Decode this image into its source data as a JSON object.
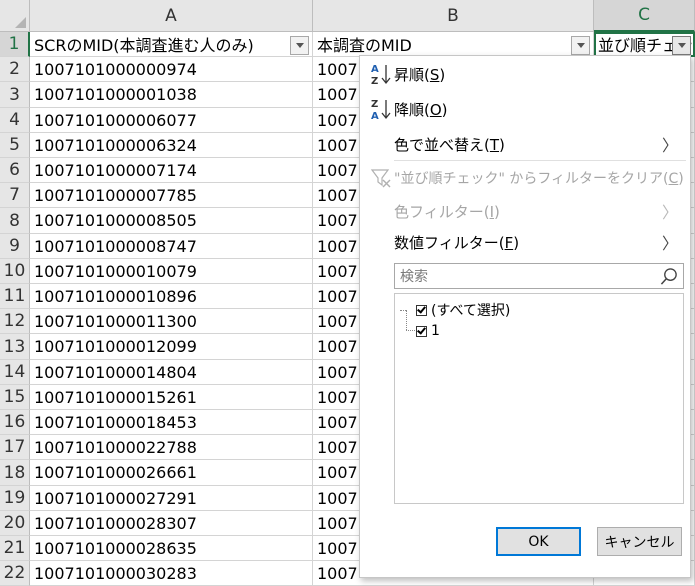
{
  "columns": [
    {
      "letter": "A",
      "header": "SCRのMID(本調査進む人のみ)"
    },
    {
      "letter": "B",
      "header": "本調査のMID"
    },
    {
      "letter": "C",
      "header": "並び順チェック"
    }
  ],
  "rows": [
    {
      "num": "1"
    },
    {
      "num": "2",
      "a": "1007101000000974",
      "b": "1007"
    },
    {
      "num": "3",
      "a": "1007101000001038",
      "b": "1007"
    },
    {
      "num": "4",
      "a": "1007101000006077",
      "b": "1007"
    },
    {
      "num": "5",
      "a": "1007101000006324",
      "b": "1007"
    },
    {
      "num": "6",
      "a": "1007101000007174",
      "b": "1007"
    },
    {
      "num": "7",
      "a": "1007101000007785",
      "b": "1007"
    },
    {
      "num": "8",
      "a": "1007101000008505",
      "b": "1007"
    },
    {
      "num": "9",
      "a": "1007101000008747",
      "b": "1007"
    },
    {
      "num": "10",
      "a": "1007101000010079",
      "b": "1007"
    },
    {
      "num": "11",
      "a": "1007101000010896",
      "b": "1007"
    },
    {
      "num": "12",
      "a": "1007101000011300",
      "b": "1007"
    },
    {
      "num": "13",
      "a": "1007101000012099",
      "b": "1007"
    },
    {
      "num": "14",
      "a": "1007101000014804",
      "b": "1007"
    },
    {
      "num": "15",
      "a": "1007101000015261",
      "b": "1007"
    },
    {
      "num": "16",
      "a": "1007101000018453",
      "b": "1007"
    },
    {
      "num": "17",
      "a": "1007101000022788",
      "b": "1007"
    },
    {
      "num": "18",
      "a": "1007101000026661",
      "b": "1007"
    },
    {
      "num": "19",
      "a": "1007101000027291",
      "b": "1007"
    },
    {
      "num": "20",
      "a": "1007101000028307",
      "b": "1007"
    },
    {
      "num": "21",
      "a": "1007101000028635",
      "b": "1007"
    },
    {
      "num": "22",
      "a": "1007101000030283",
      "b": "1007"
    }
  ],
  "filter_menu": {
    "sort_asc": {
      "label": "昇順(",
      "key": "S",
      "end": ")"
    },
    "sort_desc": {
      "label": "降順(",
      "key": "O",
      "end": ")"
    },
    "sort_by_color": {
      "label": "色で並べ替え(",
      "key": "T",
      "end": ")"
    },
    "clear_filter": {
      "label": "\"並び順チェック\" からフィルターをクリア(",
      "key": "C",
      "end": ")"
    },
    "color_filter": {
      "label": "色フィルター(",
      "key": "I",
      "end": ")"
    },
    "number_filter": {
      "label": "数値フィルター(",
      "key": "F",
      "end": ")"
    },
    "search_placeholder": "検索",
    "tree": [
      {
        "label": "(すべて選択)",
        "checked": true
      },
      {
        "label": "1",
        "checked": true
      }
    ],
    "ok_label": "OK",
    "cancel_label": "キャンセル"
  },
  "icons": {
    "sort_asc": "sort-ascending-icon",
    "sort_desc": "sort-descending-icon",
    "clear_filter": "clear-filter-icon",
    "search": "search-icon",
    "submenu": "chevron-right-icon",
    "dropdown": "dropdown-arrow-icon"
  },
  "colors": {
    "selection": "#217346",
    "default_button": "#0078d7",
    "disabled_text": "#a6a6a6"
  }
}
